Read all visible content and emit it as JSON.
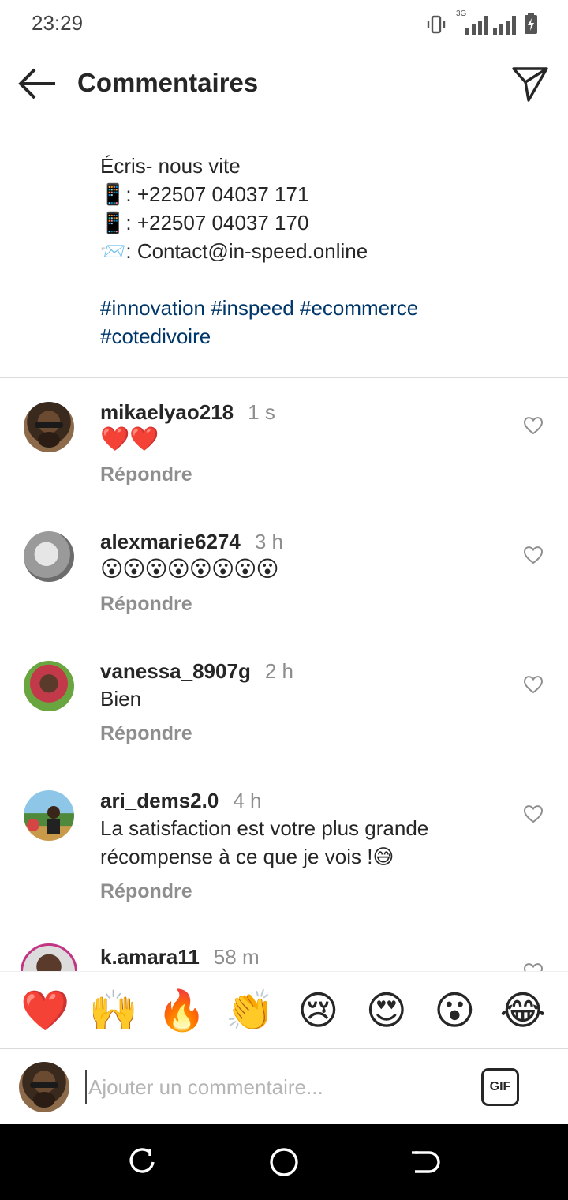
{
  "status_bar": {
    "time": "23:29",
    "network": "3G",
    "icons": [
      "vibrate-icon",
      "signal-icon",
      "signal-icon",
      "battery-charging-icon"
    ]
  },
  "header": {
    "title": "Commentaires",
    "back_icon": "arrow-left-icon",
    "share_icon": "send-icon"
  },
  "caption": {
    "lines": [
      "Écris- nous vite",
      "📱: +22507 04037 171",
      "📱: +22507 04037 170",
      "📨: Contact@in-speed.online"
    ],
    "hashtags_line1": "#innovation #inspeed #ecommerce",
    "hashtags_line2": "#cotedivoire"
  },
  "comments": [
    {
      "username": "mikaelyao218",
      "time": "1 s",
      "text": "❤️❤️",
      "reply_label": "Répondre"
    },
    {
      "username": "alexmarie6274",
      "time": "3 h",
      "text": "😮😮😮😮😮😮😮😮",
      "reply_label": "Répondre"
    },
    {
      "username": "vanessa_8907g",
      "time": "2 h",
      "text": "Bien",
      "reply_label": "Répondre"
    },
    {
      "username": "ari_dems2.0",
      "time": "4 h",
      "text": "La satisfaction est votre plus grande récompense à ce que je vois !😅",
      "reply_label": "Répondre"
    },
    {
      "username": "k.amara11",
      "time": "58 m"
    }
  ],
  "emoji_bar": [
    "❤️",
    "🙌",
    "🔥",
    "👏",
    "😢",
    "😍",
    "😮",
    "😂"
  ],
  "input": {
    "placeholder": "Ajouter un commentaire...",
    "gif_label": "GIF"
  },
  "colors": {
    "hashtag": "#00376b",
    "muted": "#8e8e8e",
    "text": "#262626"
  }
}
